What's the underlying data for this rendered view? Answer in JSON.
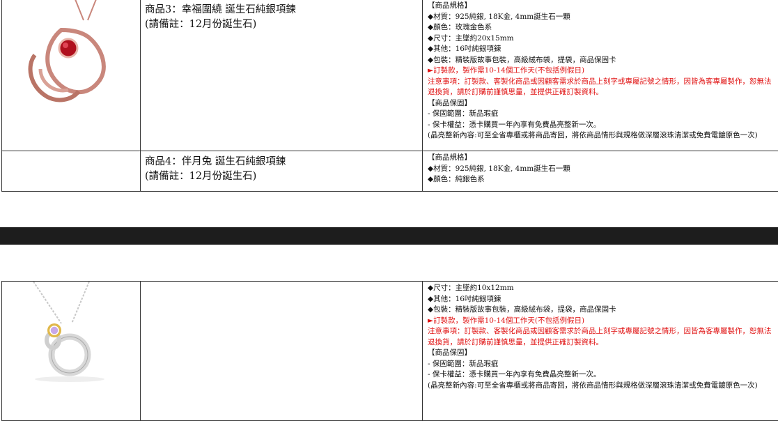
{
  "products": [
    {
      "name": "商品3：幸福圍繞 誕生石純銀項鍊",
      "note": "(請備註：12月份誕生石)",
      "spec_lines": [
        {
          "text": "【商品規格】",
          "red": false
        },
        {
          "text": "◆材質：925純銀, 18K金, 4mm誕生石一顆",
          "red": false
        },
        {
          "text": "◆顏色：玫瑰金色系",
          "red": false
        },
        {
          "text": "◆尺寸：主墜約20x15mm",
          "red": false
        },
        {
          "text": "◆其他：16吋純銀項鍊",
          "red": false
        },
        {
          "text": "◆包裝：精裝版故事包裝，高級絨布袋，提袋，商品保固卡",
          "red": false
        },
        {
          "text": "►訂製款，製作需10-14個工作天(不包括例假日)",
          "red": true
        },
        {
          "text": "注意事項：訂製款、客製化商品或因顧客需求於商品上刻字或專屬記號之情形，因皆為客專屬製作，恕無法退換貨，請於訂購前謹慎思量，並提供正確訂製資料。",
          "red": true
        },
        {
          "text": "【商品保固】",
          "red": false
        },
        {
          "text": "- 保固範圍：新品瑕疵",
          "red": false
        },
        {
          "text": "- 保卡權益：憑卡購買一年內享有免費晶亮整新一次。",
          "red": false
        },
        {
          "text": "(晶亮整新內容:可至全省專櫃或將商品寄回，將依商品情形與規格做深層滾珠清潔或免費電鍍原色一次)",
          "red": false
        }
      ]
    },
    {
      "name": "商品4：伴月兔 誕生石純銀項鍊",
      "note": "(請備註：12月份誕生石)",
      "spec_lines": [
        {
          "text": "【商品規格】",
          "red": false
        },
        {
          "text": "◆材質：925純銀, 18K金, 4mm誕生石一顆",
          "red": false
        },
        {
          "text": "◆顏色：純銀色系",
          "red": false
        }
      ]
    },
    {
      "name": "",
      "note": "",
      "spec_lines": [
        {
          "text": "◆尺寸：主墜約10x12mm",
          "red": false
        },
        {
          "text": "◆其他：16吋純銀項鍊",
          "red": false
        },
        {
          "text": "◆包裝：精裝版故事包裝，高級絨布袋，提袋，商品保固卡",
          "red": false
        },
        {
          "text": "►訂製款，製作需10-14個工作天(不包括例假日)",
          "red": true
        },
        {
          "text": "注意事項：訂製款、客製化商品或因顧客需求於商品上刻字或專屬記號之情形，因皆為客專屬製作，恕無法退換貨，請於訂購前謹慎思量，並提供正確訂製資料。",
          "red": true
        },
        {
          "text": "【商品保固】",
          "red": false
        },
        {
          "text": "- 保固範圍：新品瑕疵",
          "red": false
        },
        {
          "text": "- 保卡權益：憑卡購買一年內享有免費晶亮整新一次。",
          "red": false
        },
        {
          "text": "(晶亮整新內容:可至全省專櫃或將商品寄回，將依商品情形與規格做深層滾珠清潔或免費電鍍原色一次)",
          "red": false
        }
      ]
    }
  ],
  "colors": {
    "red": "#e01010",
    "band": "#1d1d1d",
    "rose_gold": "#c9877c",
    "ruby": "#b0101e",
    "silver": "#c8c8c8"
  },
  "icons": [
    "heart-pendant-necklace-image",
    "moon-rabbit-pendant-necklace-image"
  ]
}
